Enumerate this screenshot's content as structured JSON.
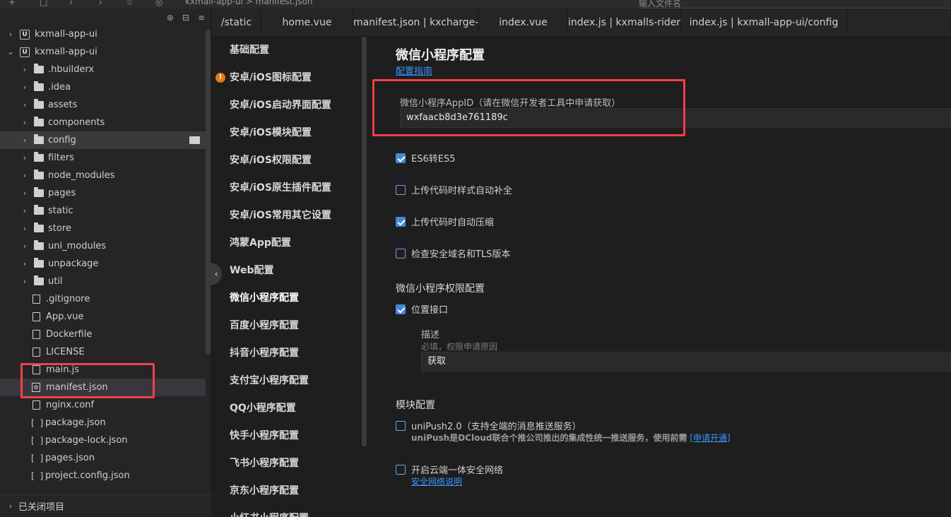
{
  "topbar": {
    "breadcrumb": "kxmall-app-ui  >  manifest.json",
    "search_placeholder": "输入文件名"
  },
  "sidebar": {
    "tree": [
      {
        "label": "kxmall-app-ui",
        "kind": "project",
        "expanded": false
      },
      {
        "label": "kxmall-app-ui",
        "kind": "project",
        "expanded": true
      },
      {
        "label": ".hbuilderx",
        "kind": "folder"
      },
      {
        "label": ".idea",
        "kind": "folder"
      },
      {
        "label": "assets",
        "kind": "folder"
      },
      {
        "label": "components",
        "kind": "folder"
      },
      {
        "label": "config",
        "kind": "folder"
      },
      {
        "label": "filters",
        "kind": "folder"
      },
      {
        "label": "node_modules",
        "kind": "folder"
      },
      {
        "label": "pages",
        "kind": "folder"
      },
      {
        "label": "static",
        "kind": "folder"
      },
      {
        "label": "store",
        "kind": "folder"
      },
      {
        "label": "uni_modules",
        "kind": "folder"
      },
      {
        "label": "unpackage",
        "kind": "folder"
      },
      {
        "label": "util",
        "kind": "folder"
      },
      {
        "label": ".gitignore",
        "kind": "file"
      },
      {
        "label": "App.vue",
        "kind": "file"
      },
      {
        "label": "Dockerfile",
        "kind": "file"
      },
      {
        "label": "LICENSE",
        "kind": "file"
      },
      {
        "label": "main.js",
        "kind": "file"
      },
      {
        "label": "manifest.json",
        "kind": "manifest"
      },
      {
        "label": "nginx.conf",
        "kind": "file"
      },
      {
        "label": "package.json",
        "kind": "json"
      },
      {
        "label": "package-lock.json",
        "kind": "json"
      },
      {
        "label": "pages.json",
        "kind": "json"
      },
      {
        "label": "project.config.json",
        "kind": "json"
      }
    ],
    "closed_projects": "已关闭项目"
  },
  "tabs": [
    "/static",
    "home.vue",
    "manifest.json | kxcharge-uniapp",
    "index.vue",
    "index.js | kxmalls-rider-ui/config",
    "index.js | kxmall-app-ui/config"
  ],
  "settings_nav": [
    "基础配置",
    "安卓/iOS图标配置",
    "安卓/iOS启动界面配置",
    "安卓/iOS模块配置",
    "安卓/iOS权限配置",
    "安卓/iOS原生插件配置",
    "安卓/iOS常用其它设置",
    "鸿蒙App配置",
    "Web配置",
    "微信小程序配置",
    "百度小程序配置",
    "抖音小程序配置",
    "支付宝小程序配置",
    "QQ小程序配置",
    "快手小程序配置",
    "飞书小程序配置",
    "京东小程序配置",
    "小红书小程序配置"
  ],
  "content": {
    "title": "微信小程序配置",
    "guide_link": "配置指南",
    "appid_label": "微信小程序AppID（请在微信开发者工具中申请获取）",
    "appid_value": "wxfaacb8d3e761189c",
    "opt_es6": "ES6转ES5",
    "opt_postcss": "上传代码时样式自动补全",
    "opt_minify": "上传代码时自动压缩",
    "opt_check_domain": "检查安全域名和TLS版本",
    "perm_title": "微信小程序权限配置",
    "perm_location": "位置接口",
    "desc_label": "描述",
    "desc_hint": "必填，权限申请原因",
    "desc_value": "获取",
    "module_title": "模块配置",
    "unipush_label": "uniPush2.0（支持全端的消息推送服务）",
    "unipush_note_bold": "uniPush是DCloud联合个推公司推出的集成性统一推送服务，使用前需",
    "unipush_note_link": "[申请开通]",
    "secure_label": "开启云端一体安全网络",
    "secure_link": "安全网络说明"
  },
  "colors": {
    "accent": "#3794ff",
    "highlight": "#f0404a",
    "warning": "#e07a1a"
  }
}
